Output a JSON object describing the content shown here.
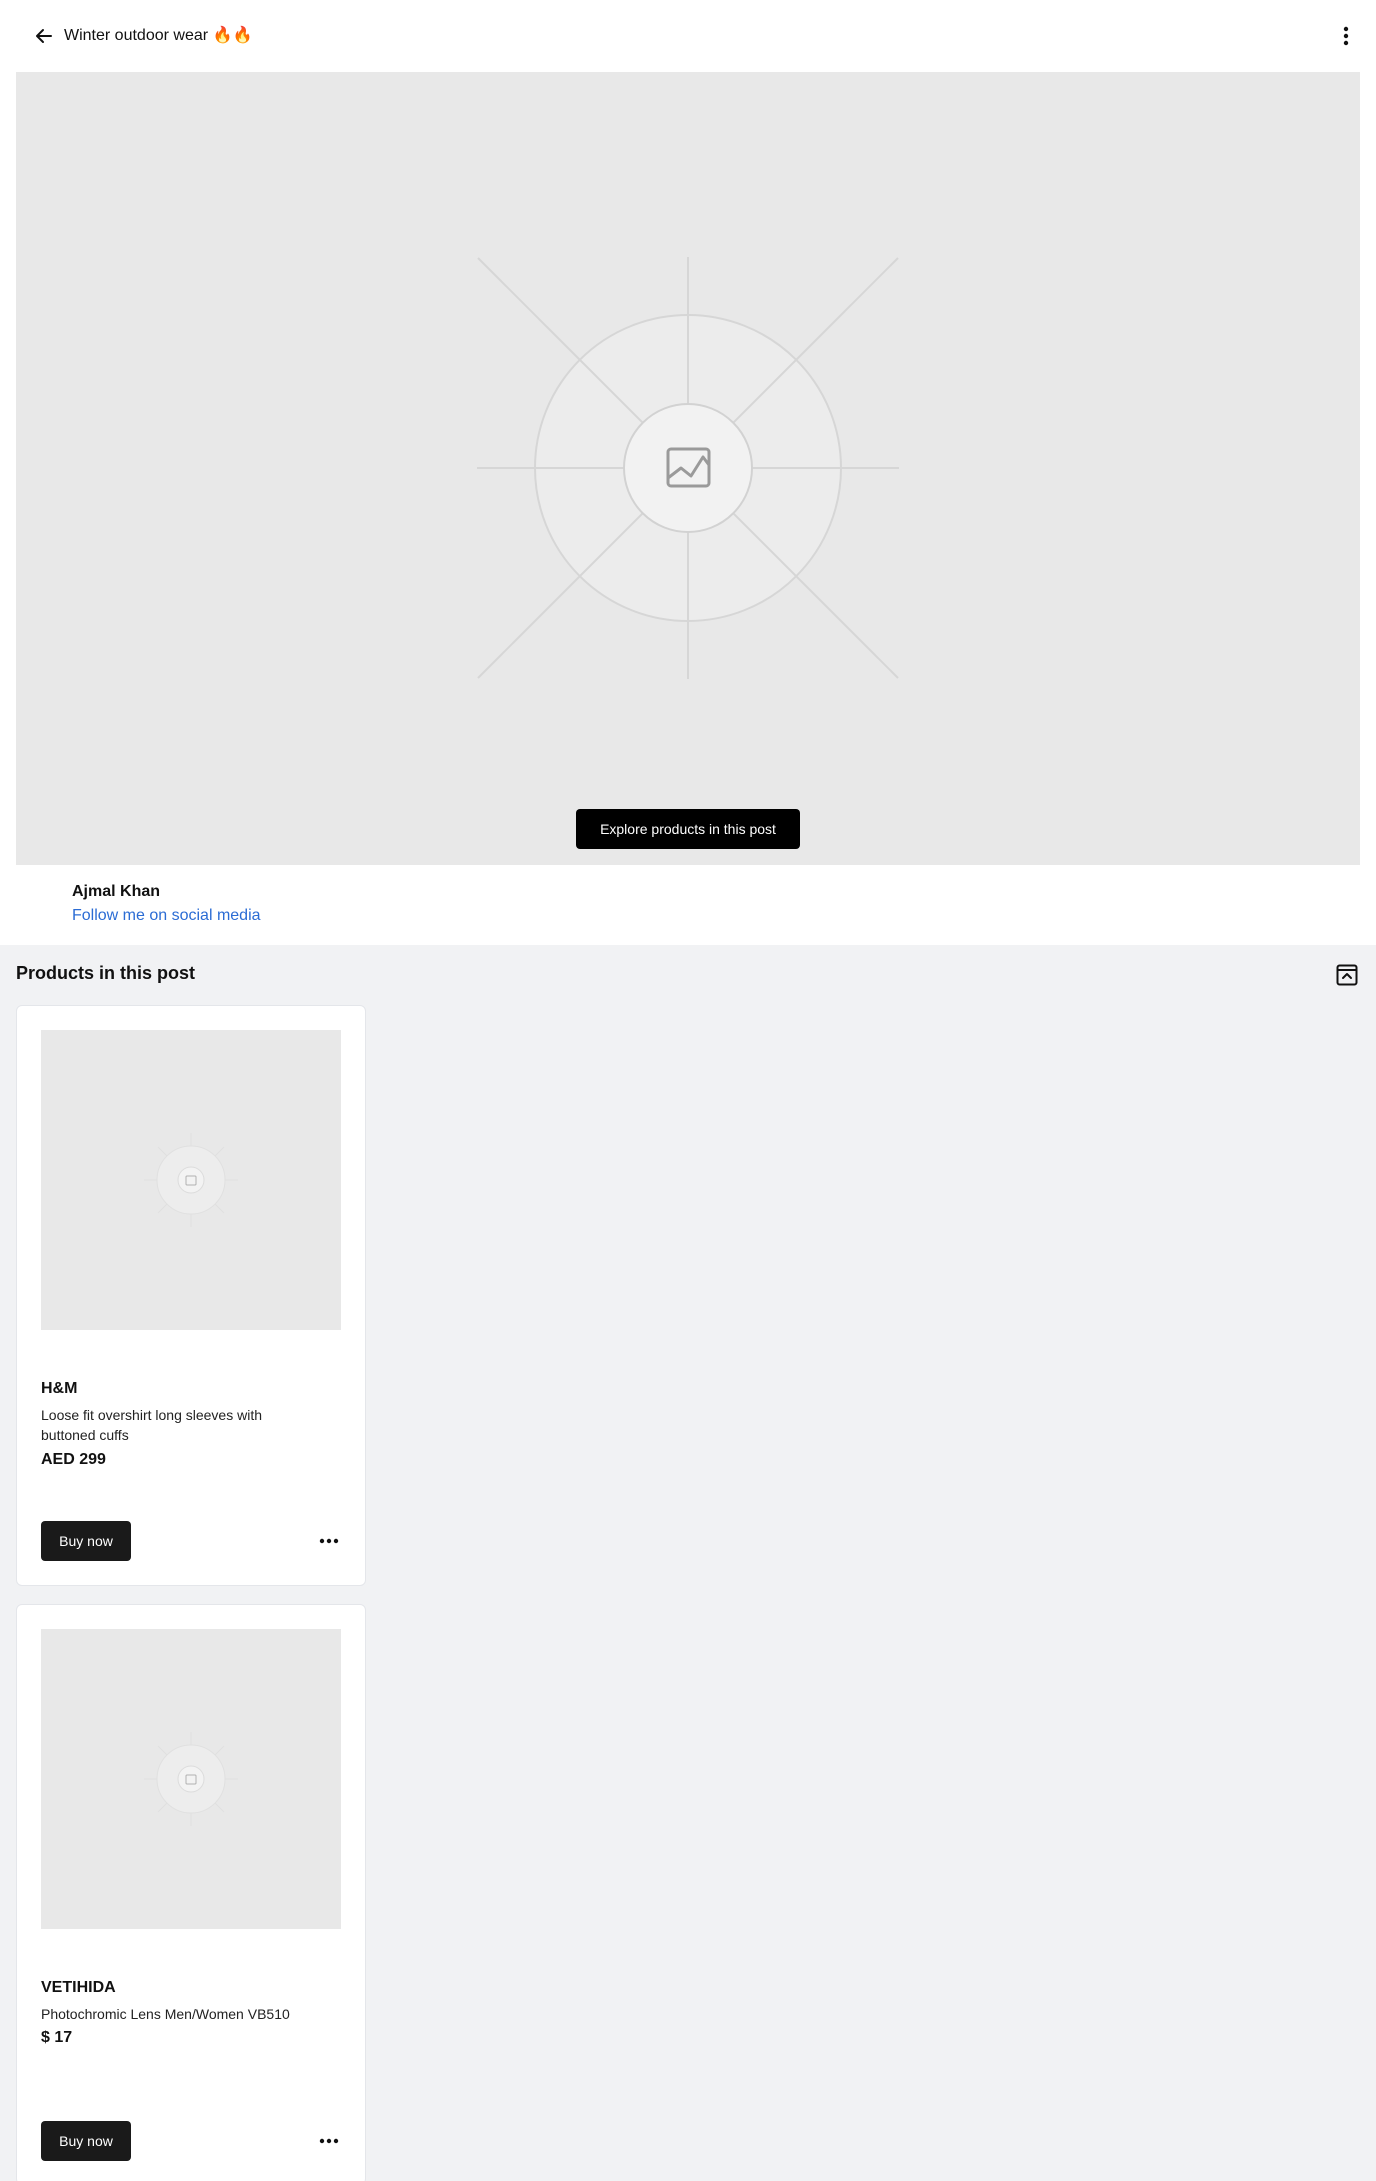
{
  "header": {
    "title": "Winter outdoor wear",
    "title_emoji": "🔥🔥",
    "back_icon": "arrow-left-icon",
    "more_icon": "vertical-dots-icon"
  },
  "hero": {
    "image_icon": "image-placeholder-icon",
    "explore_label": "Explore products in this post"
  },
  "author": {
    "name": "Ajmal Khan",
    "link": "Follow me on social media"
  },
  "products": {
    "title": "Products in this post",
    "collapse_icon": "collapse-panel-icon",
    "items": [
      {
        "brand": "H&M",
        "description": "Loose fit overshirt long sleeves with buttoned cuffs",
        "price": "AED 299",
        "buy_label": "Buy now"
      },
      {
        "brand": "VETIHIDA",
        "description": "Photochromic Lens Men/Women VB510",
        "price": "$ 17",
        "buy_label": "Buy now"
      }
    ]
  },
  "colors": {
    "link": "#2b6cd4",
    "button": "#1a1a1a",
    "section_bg": "#f1f2f4",
    "placeholder_bg": "#e8e8e8"
  }
}
